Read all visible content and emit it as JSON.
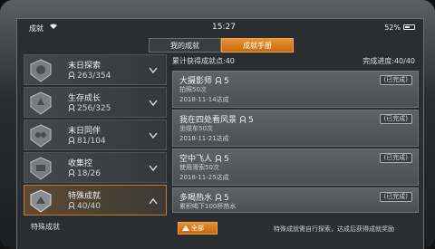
{
  "status_bar": {
    "carrier": "成就",
    "time": "15:27",
    "battery": "52%"
  },
  "tabs": [
    {
      "label": "我的成就",
      "active": false
    },
    {
      "label": "成就手册",
      "active": true
    }
  ],
  "categories": [
    {
      "name": "末日探索",
      "count": "263/354",
      "active": false
    },
    {
      "name": "生存成长",
      "count": "256/325",
      "active": false
    },
    {
      "name": "末日同伴",
      "count": "81/104",
      "active": false
    },
    {
      "name": "收集控",
      "count": "18/26",
      "active": false
    },
    {
      "name": "特殊成就",
      "count": "40/40",
      "active": true
    }
  ],
  "footer_label": "特殊成就",
  "summary": {
    "total_points": "累计获得成就点:40",
    "progress": "完成进度:40/40"
  },
  "achievements": [
    {
      "title": "大摄影师",
      "points": "5",
      "status": "(已完成)",
      "desc": "拍照50次",
      "date": "2018-11-14达成"
    },
    {
      "title": "我在四处看风景",
      "points": "5",
      "status": "(已完成)",
      "desc": "坐缆车50次",
      "date": "2018-11-21达成"
    },
    {
      "title": "空中飞人",
      "points": "5",
      "status": "(已完成)",
      "desc": "使用滑索50次",
      "date": "2018-11-25达成"
    },
    {
      "title": "多喝热水",
      "points": "5",
      "status": "(已完成)",
      "desc": "累积喝下100杯热水",
      "date": ""
    }
  ],
  "filter_button": "全部",
  "hint": "特殊成就需自行探索，达成后获得成就奖励",
  "colors": {
    "accent": "#d9791f",
    "panel": "#4c4f53",
    "background": "#2b2e31"
  }
}
